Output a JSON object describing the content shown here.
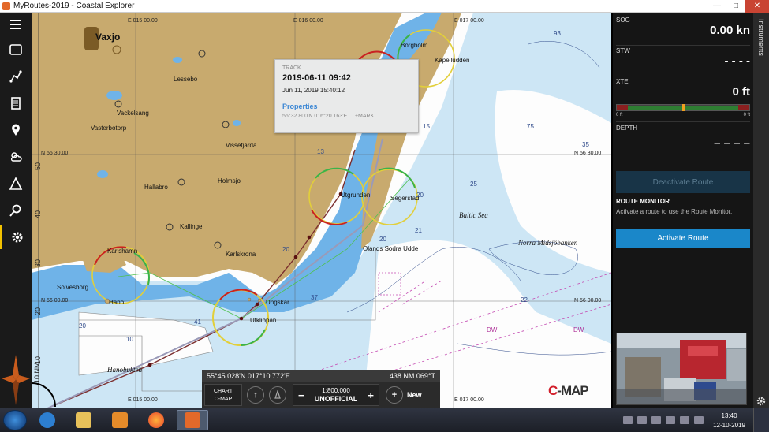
{
  "window": {
    "title": "MyRoutes-2019 - Coastal Explorer",
    "minimize": "—",
    "maximize": "□",
    "close": "✕"
  },
  "toolbar": {
    "items": [
      {
        "icon": "menu-icon"
      },
      {
        "icon": "window-icon"
      },
      {
        "icon": "route-icon"
      },
      {
        "icon": "pages-icon"
      },
      {
        "icon": "mark-pin-icon"
      },
      {
        "icon": "weather-icon"
      },
      {
        "icon": "triangle-icon"
      },
      {
        "icon": "search-icon"
      },
      {
        "icon": "settings-gear-icon"
      }
    ]
  },
  "chart": {
    "longitudes": [
      "E 015 00.00",
      "E 016 00.00",
      "E 017 00.00",
      "E 015 00.00",
      "E 017 00.00"
    ],
    "latitudes": [
      "N 56 30.00",
      "N 56 30.00",
      "N 56 00.00",
      "N 56 00.00"
    ],
    "lat_ticks": [
      "50",
      "40",
      "30",
      "20",
      "10"
    ],
    "places": {
      "vaxjo": "Vaxjo",
      "lessebo": "Lessebo",
      "vackelsang": "Vackelsang",
      "vasterbotorp": "Vasterbotorp",
      "vissefjarda": "Vissefjarda",
      "hallabro": "Hallabro",
      "holmsjo": "Holmsjo",
      "kallinge": "Kallinge",
      "karlshamn": "Karlshamn",
      "karlskrona": "Karlskrona",
      "solvesborg": "Solvesborg",
      "hano": "Hano",
      "hanobukten": "Hanobukten",
      "utklippan": "Utklippan",
      "ungskar": "Ungskar",
      "utgrunden": "Utgrunden",
      "segerstad": "Segerstad",
      "olands_sodra_udde": "Olands Sodra Udde",
      "borgholm": "Borgholm",
      "kapelludden": "Kapelludden",
      "baltic_sea": "Baltic Sea",
      "norra_midsjobanken": "Norra Midsjöbanken"
    },
    "depths": [
      "93",
      "75",
      "35",
      "15",
      "20",
      "21",
      "37",
      "41",
      "20",
      "22",
      "25",
      "20",
      "10",
      "20",
      "13"
    ],
    "dw_labels": [
      "DW",
      "DW"
    ]
  },
  "popup": {
    "kind": "TRACK",
    "name": "2019-06-11 09:42",
    "timestamp": "Jun 11, 2019 15:40:12",
    "properties_link": "Properties",
    "coords": "56°32.800'N 016°20.163'E",
    "mark_link": "+MARK"
  },
  "cursor": {
    "position": "55°45.028'N  017°10.772'E",
    "range_bearing": "438 NM  069°T"
  },
  "controls": {
    "chart_label_top": "CHART",
    "chart_label_bottom": "C-MAP",
    "up_icon": "↑",
    "minus": "−",
    "plus": "+",
    "scale": "1:800,000",
    "scale_status": "UNOFFICIAL",
    "new_label": "New",
    "new_icon": "+"
  },
  "scale_nm": "10 NM",
  "logo": {
    "left": "C",
    "right": "-MAP"
  },
  "instruments": {
    "tab_label": "Instruments",
    "sog": {
      "label": "SOG",
      "value": "0.00 kn"
    },
    "stw": {
      "label": "STW",
      "value": "- - - -"
    },
    "xte": {
      "label": "XTE",
      "value": "0 ft",
      "scale_left": "0 ft",
      "scale_right": "0 ft",
      "offset_fraction": 0.5
    },
    "depth": {
      "label": "DEPTH",
      "value": "– – – –"
    },
    "deactivate_route": "Deactivate Route",
    "route_monitor_title": "ROUTE MONITOR",
    "route_monitor_text": "Activate a route to use the Route Monitor.",
    "activate_route": "Activate Route"
  },
  "taskbar": {
    "time": "13:40",
    "date": "12-10-2019",
    "apps": [
      "internet-explorer-icon",
      "file-explorer-icon",
      "media-player-icon",
      "firefox-icon",
      "coastal-explorer-icon"
    ]
  },
  "colors": {
    "land": "#c8aa6e",
    "shallow_water": "#6fb3e8",
    "mid_water": "#cde6f5",
    "deep_water": "#fdfdfd",
    "route": "#7c2f2f",
    "accent_button": "#1a87c9"
  }
}
